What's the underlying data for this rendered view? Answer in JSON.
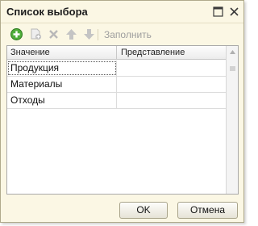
{
  "window": {
    "title": "Список выбора"
  },
  "titlebar": {
    "maximize_icon": "maximize-icon",
    "close_icon": "close-icon"
  },
  "toolbar": {
    "icons": [
      "add-icon",
      "copy-icon",
      "delete-icon",
      "move-up-icon",
      "move-down-icon"
    ],
    "fill_label": "Заполнить"
  },
  "table": {
    "columns": [
      "Значение",
      "Представление"
    ],
    "rows": [
      {
        "value": "Продукция",
        "presentation": ""
      },
      {
        "value": "Материалы",
        "presentation": ""
      },
      {
        "value": "Отходы",
        "presentation": ""
      }
    ],
    "selected_row": 0
  },
  "buttons": {
    "ok_label": "OK",
    "cancel_label": "Отмена"
  },
  "colors": {
    "window_bg": "#fbf7e4",
    "add_green": "#3a9b2c",
    "disabled_gray": "#b8b8b8"
  }
}
